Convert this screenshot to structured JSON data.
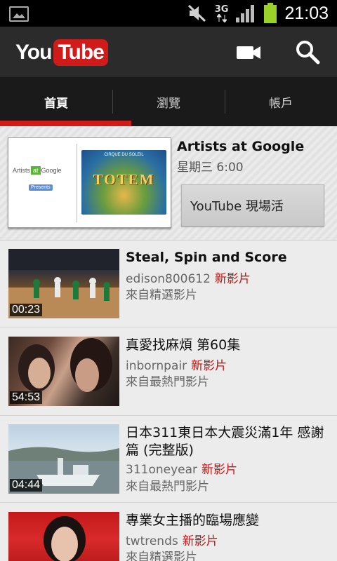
{
  "status_bar": {
    "network": "3G",
    "time": "21:03"
  },
  "header": {
    "logo_you": "You",
    "logo_tube": "Tube",
    "camera_icon": "video-camera-icon",
    "search_icon": "search-icon"
  },
  "tabs": [
    {
      "label": "首頁",
      "active": true
    },
    {
      "label": "瀏覽",
      "active": false
    },
    {
      "label": "帳戶",
      "active": false
    }
  ],
  "promo": {
    "title": "Artists at Google",
    "time": "星期三 6:00",
    "button_label": "YouTube 現場活",
    "thumb_logo_left": "Artists",
    "thumb_logo_at": "at",
    "thumb_logo_right": "Google",
    "thumb_presents": "Presents",
    "thumb_top_text": "CIRQUE DU SOLEIL",
    "thumb_word": "TOTEM"
  },
  "videos": [
    {
      "title": "Steal, Spin and Score",
      "channel": "edison800612",
      "badge": "新影片",
      "source": "來自精選影片",
      "duration": "00:23"
    },
    {
      "title": "真愛找麻煩 第60集",
      "channel": "inbornpair",
      "badge": "新影片",
      "source": "來自最熱門影片",
      "duration": "54:53"
    },
    {
      "title": "日本311東日本大震災滿1年 感謝篇 (完整版)",
      "channel": "311oneyear",
      "badge": "新影片",
      "source": "來自最熱門影片",
      "duration": "04:44"
    },
    {
      "title": "專業女主播的臨場應變",
      "channel": "twtrends",
      "badge": "新影片",
      "source": "來自精選影片",
      "duration": ""
    }
  ],
  "colors": {
    "brand_red": "#d01b1b",
    "new_badge": "#cc1010"
  }
}
